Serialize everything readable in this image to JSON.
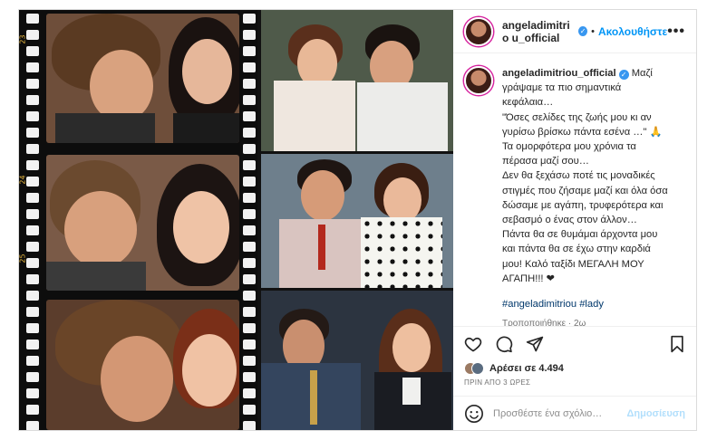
{
  "post": {
    "username": "angeladimitriou_official",
    "username_wrapped": "angeladimitrio u_official",
    "follow_label": "Ακολουθήστε",
    "more_label": "•••",
    "caption_lines": [
      "Μαζί",
      "γράψαμε τα πιο σημαντικά",
      "κεφάλαια…",
      "\"Όσες σελίδες της ζωής μου κι αν",
      "γυρίσω βρίσκω πάντα εσένα …\" 🙏",
      "Τα ομορφότερα μου χρόνια τα",
      "πέρασα μαζί σου…",
      "Δεν θα ξεχάσω ποτέ τις μοναδικές",
      "στιγμές που ζήσαμε μαζί και όλα όσα",
      "δώσαμε με αγάπη, τρυφερότερα και",
      "σεβασμό ο ένας στον άλλον…",
      "Πάντα θα σε θυμάμαι άρχοντα μου",
      "και πάντα θα σε έχω στην καρδιά",
      "μου! Καλό ταξίδι ΜΕΓΑΛΗ ΜΟΥ",
      "ΑΓΑΠΗ!!! ❤"
    ],
    "hashtags": "#angeladimitriou #lady",
    "edited_label": "Τροποποιήθηκε · 2ω",
    "likes_label": "Αρέσει σε 4.494",
    "time_label": "ΠΡΙΝ ΑΠΟ 3 ΩΡΕΣ",
    "comment_placeholder": "Προσθέστε ένα σχόλιο…",
    "post_button": "Δημοσίευση",
    "film_numbers": [
      "23",
      "24",
      "25"
    ]
  },
  "colors": {
    "accent": "#0095f6",
    "verified": "#3897f0",
    "border": "#dbdbdb",
    "post_disabled": "#b2dffc"
  }
}
